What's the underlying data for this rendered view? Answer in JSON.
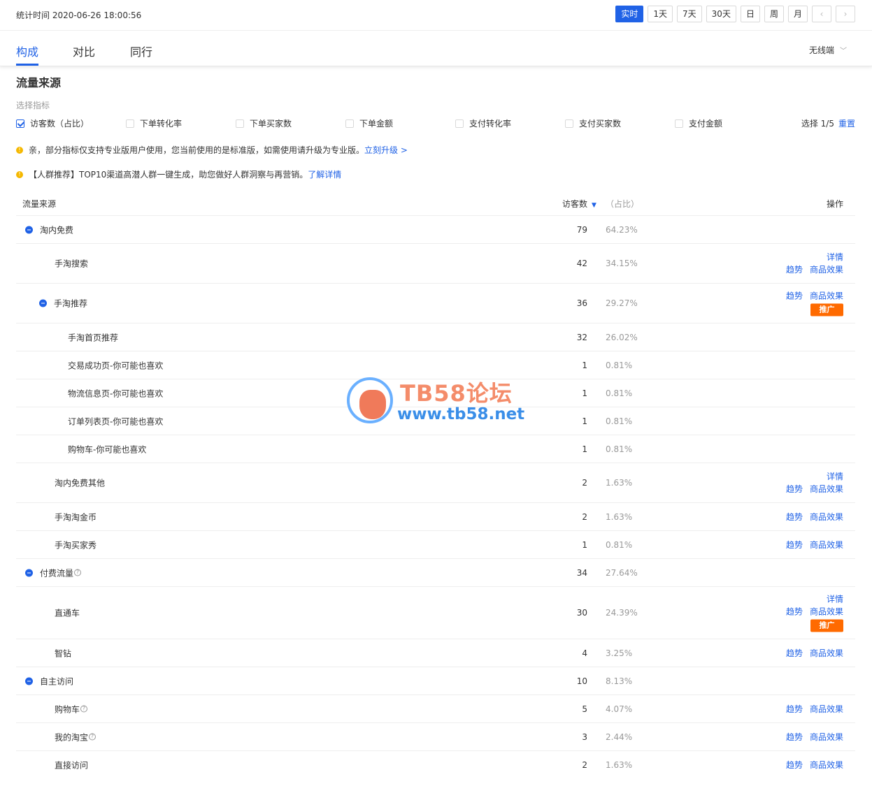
{
  "header": {
    "stat_time": "统计时间 2020-06-26 18:00:56",
    "time_buttons": [
      "实时",
      "1天",
      "7天",
      "30天",
      "日",
      "周",
      "月"
    ],
    "prev_arrow": "‹",
    "next_arrow": "›"
  },
  "tabs": [
    {
      "label": "构成",
      "active": true
    },
    {
      "label": "对比",
      "active": false
    },
    {
      "label": "同行",
      "active": false
    }
  ],
  "device_select": {
    "value": "无线端",
    "icon": "chevron-down-icon"
  },
  "section": {
    "title": "流量来源",
    "select_label": "选择指标",
    "indicators": [
      {
        "label": "访客数（占比）",
        "checked": true
      },
      {
        "label": "下单转化率",
        "checked": false
      },
      {
        "label": "下单买家数",
        "checked": false
      },
      {
        "label": "下单金额",
        "checked": false
      },
      {
        "label": "支付转化率",
        "checked": false
      },
      {
        "label": "支付买家数",
        "checked": false
      },
      {
        "label": "支付金额",
        "checked": false
      }
    ],
    "selected_count": "选择 1/5",
    "reset_label": "重置"
  },
  "notices": [
    {
      "text": "亲，部分指标仅支持专业版用户使用，您当前使用的是标准版，如需使用请升级为专业版。",
      "link": "立刻升级 >"
    },
    {
      "text": "【人群推荐】TOP10渠道高潜人群一键生成，助您做好人群洞察与再营销。",
      "link": "了解详情"
    }
  ],
  "table": {
    "headers": {
      "source": "流量来源",
      "visitors": "访客数",
      "ratio": "（占比）",
      "ops": "操作"
    },
    "op_labels": {
      "trend": "趋势",
      "effect": "商品效果",
      "detail": "详情",
      "promo": "推广"
    },
    "rows": [
      {
        "name": "淘内免费",
        "visitors": "79",
        "ratio": "64.23%"
      },
      {
        "name": "手淘搜索",
        "visitors": "42",
        "ratio": "34.15%"
      },
      {
        "name": "手淘推荐",
        "visitors": "36",
        "ratio": "29.27%"
      },
      {
        "name": "手淘首页推荐",
        "visitors": "32",
        "ratio": "26.02%"
      },
      {
        "name": "交易成功页-你可能也喜欢",
        "visitors": "1",
        "ratio": "0.81%"
      },
      {
        "name": "物流信息页-你可能也喜欢",
        "visitors": "1",
        "ratio": "0.81%"
      },
      {
        "name": "订单列表页-你可能也喜欢",
        "visitors": "1",
        "ratio": "0.81%"
      },
      {
        "name": "购物车-你可能也喜欢",
        "visitors": "1",
        "ratio": "0.81%"
      },
      {
        "name": "淘内免费其他",
        "visitors": "2",
        "ratio": "1.63%"
      },
      {
        "name": "手淘淘金币",
        "visitors": "2",
        "ratio": "1.63%"
      },
      {
        "name": "手淘买家秀",
        "visitors": "1",
        "ratio": "0.81%"
      },
      {
        "name": "付费流量",
        "visitors": "34",
        "ratio": "27.64%"
      },
      {
        "name": "直通车",
        "visitors": "30",
        "ratio": "24.39%"
      },
      {
        "name": "智钻",
        "visitors": "4",
        "ratio": "3.25%"
      },
      {
        "name": "自主访问",
        "visitors": "10",
        "ratio": "8.13%"
      },
      {
        "name": "购物车",
        "visitors": "5",
        "ratio": "4.07%"
      },
      {
        "name": "我的淘宝",
        "visitors": "3",
        "ratio": "2.44%"
      },
      {
        "name": "直接访问",
        "visitors": "2",
        "ratio": "1.63%"
      }
    ]
  },
  "watermark": {
    "title": "TB58论坛",
    "url": "www.tb58.net"
  },
  "colors": {
    "accent": "#2062e6",
    "promo": "#ff6a00",
    "warning": "#f5b800"
  }
}
